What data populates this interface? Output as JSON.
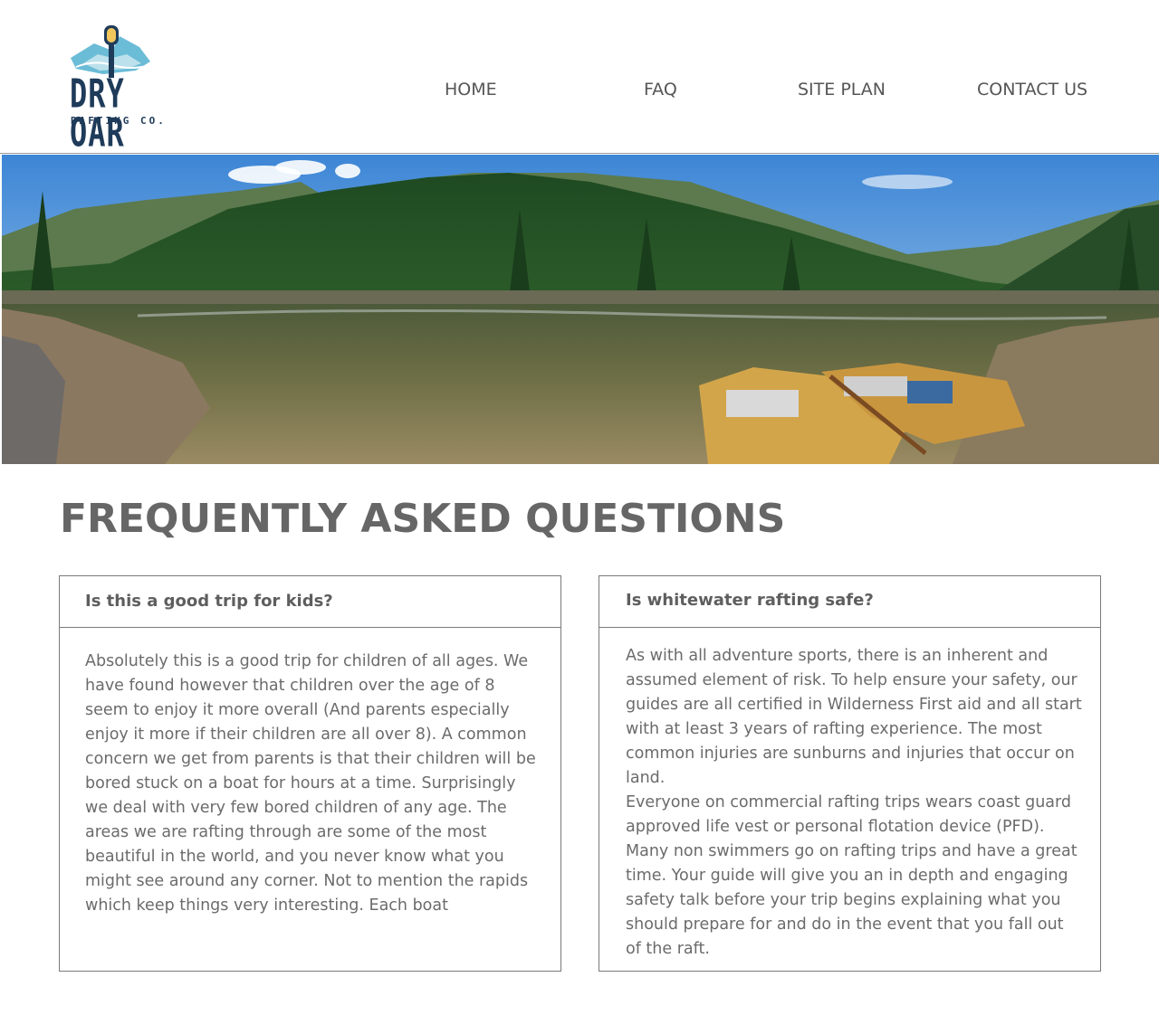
{
  "brand": {
    "name": "DRY OAR",
    "tagline": "RAFTING CO."
  },
  "nav": {
    "items": [
      {
        "label": "HOME"
      },
      {
        "label": "FAQ"
      },
      {
        "label": "SITE PLAN"
      },
      {
        "label": "CONTACT US"
      }
    ]
  },
  "page": {
    "title": "FREQUENTLY ASKED QUESTIONS"
  },
  "faq": [
    {
      "question": "Is this a good trip for kids?",
      "answer": [
        "Absolutely this is a good trip for children of all ages. We have found however that children over the age of 8 seem to enjoy it more overall (And parents especially enjoy it more if their children are all over 8). A common concern we get from parents is that their children will be bored stuck on a boat for hours at a time. Surprisingly we deal with very few bored children of any age. The areas we are rafting through are some of the most beautiful in the world, and you never know what you might see around any corner. Not to mention the rapids which keep things very interesting. Each boat"
      ]
    },
    {
      "question": "Is whitewater rafting safe?",
      "answer": [
        "As with all adventure sports, there is an inherent and assumed element of risk. To help ensure your safety, our guides are all certified in Wilderness First aid and all start with at least 3 years of rafting experience. The most common injuries are sunburns and injuries that occur on land.",
        "Everyone on commercial rafting trips wears coast guard approved life vest or personal flotation device (PFD). Many non swimmers go on rafting trips and have a great time. Your guide will give you an in depth and engaging safety talk before your trip begins explaining what you should prepare for and do in the event that you fall out of the raft."
      ]
    }
  ],
  "colors": {
    "logo_navy": "#1f3b5a",
    "logo_sky": "#6bbcd6",
    "logo_gold": "#f1c75b",
    "text_gray": "#6b6b6b",
    "border_gray": "#7a7a7a"
  }
}
